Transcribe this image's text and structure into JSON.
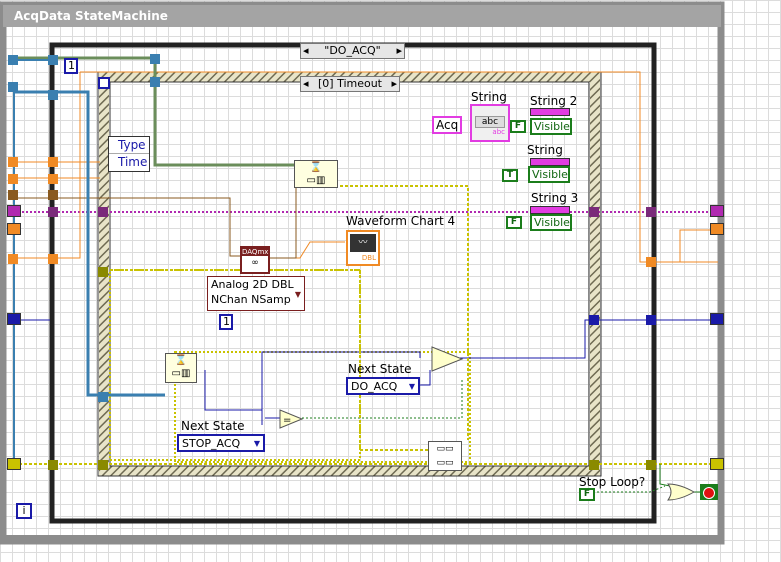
{
  "window": {
    "title": "AcqData StateMachine"
  },
  "outer_case": {
    "selector": "\"DO_ACQ\"",
    "left_arrow": "◂",
    "right_arrow": "▸"
  },
  "inner_case": {
    "selector": "[0] Timeout",
    "left_arrow": "◂",
    "right_arrow": "▸"
  },
  "constants": {
    "loop_count": "1",
    "samples": "1",
    "acq_string": "Acq",
    "iteration": "i"
  },
  "unbundle": {
    "type": "Type",
    "time": "Time"
  },
  "daqmx": {
    "name": "DAQmx",
    "mode_line1": "Analog 2D DBL",
    "mode_line2": "NChan NSamp"
  },
  "indicators": {
    "string": "String",
    "string2": "String 2",
    "string2_prop": "Visible",
    "string_visible_label": "String",
    "string_visible_prop": "Visible",
    "string3": "String 3",
    "string3_prop": "Visible",
    "abc": "abc",
    "abc2": "abc",
    "waveform": "Waveform Chart 4",
    "waveform_type": "DBL"
  },
  "booleans": {
    "false1": "F",
    "true1": "T",
    "false2": "F",
    "stop_false": "F"
  },
  "next_state_1": {
    "label": "Next State",
    "value": "DO_ACQ"
  },
  "next_state_2": {
    "label": "Next State",
    "value": "STOP_ACQ"
  },
  "stop": {
    "label": "Stop Loop?"
  },
  "colors": {
    "enum_blue": "#1a1aa8",
    "bool_green": "#1b7d1b",
    "string_pink": "#e23ce2",
    "dbl_orange": "#f08a24",
    "error_yellow": "#c9c200",
    "cluster_brown": "#8a5a1f"
  }
}
